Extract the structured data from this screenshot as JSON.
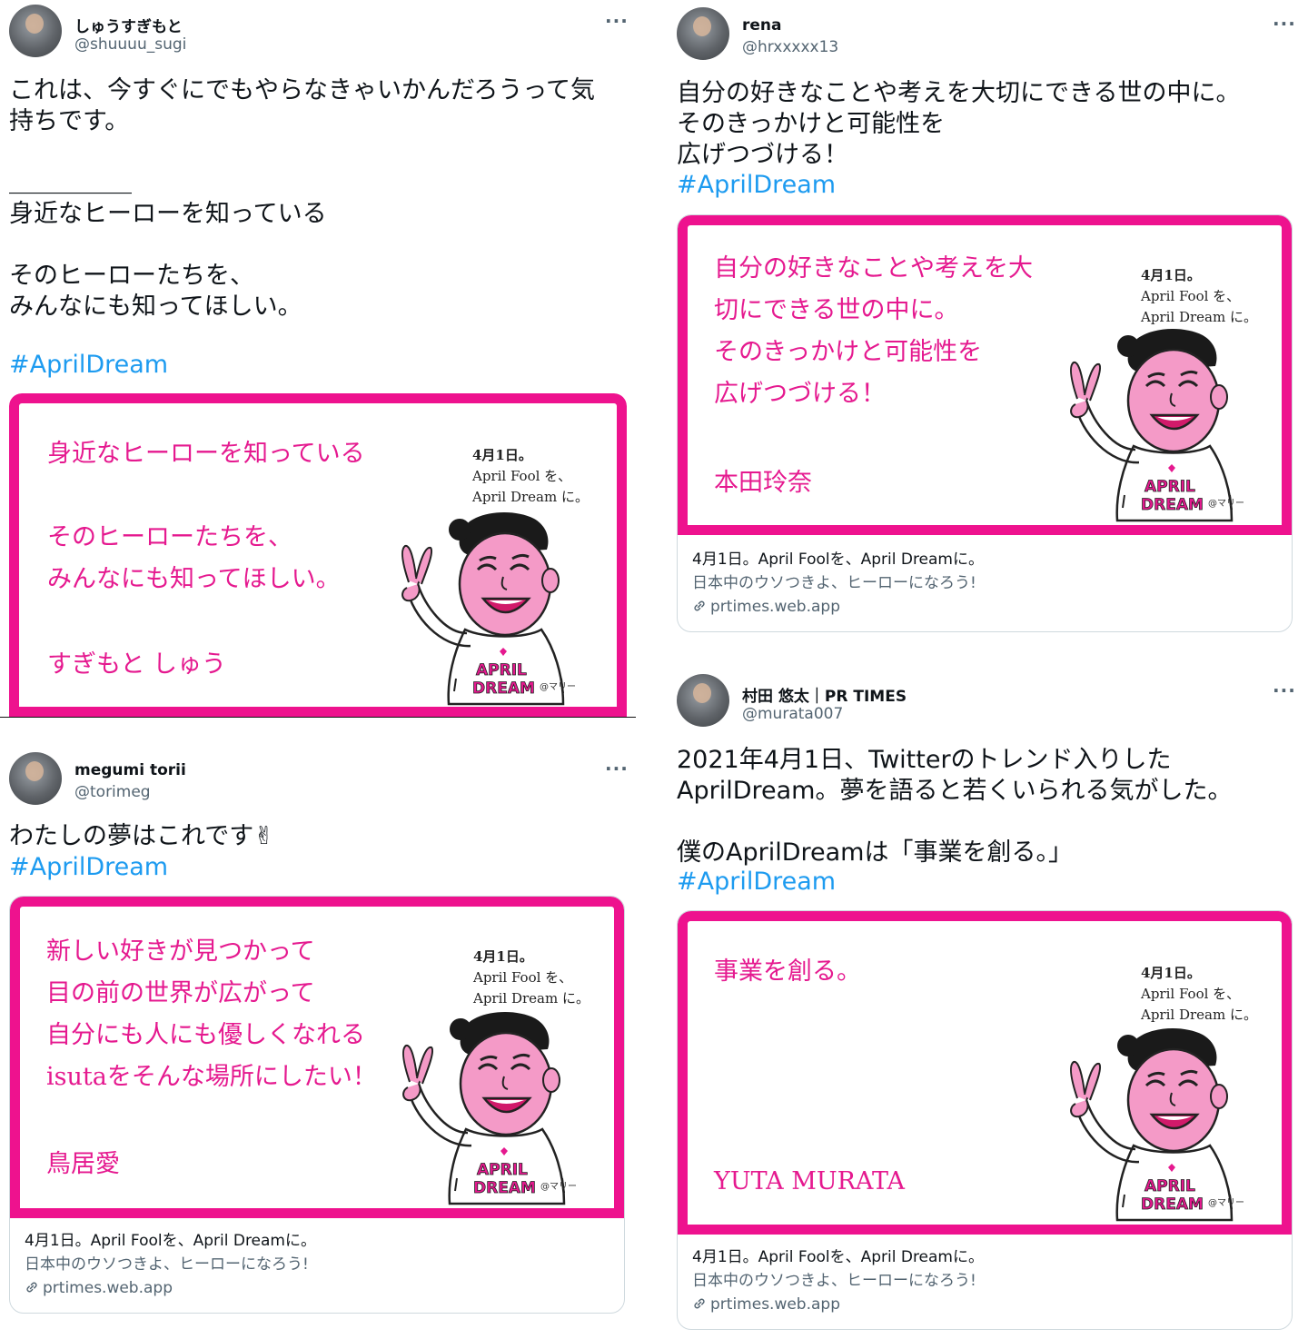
{
  "shared_card": {
    "header_line1": "4月1日。",
    "header_line2": "April Fool を、",
    "header_line3": "April Dream に。",
    "credit": "@マリー",
    "shirt_text": "APRIL DREAM",
    "link_title": "4月1日。April Foolを、April Dreamに。",
    "link_desc": "日本中のウソつきよ、ヒーローになろう!",
    "link_domain": "prtimes.web.app"
  },
  "colors": {
    "accent_pink": "#ee128e",
    "link_blue": "#1d9bf0",
    "muted": "#536471"
  },
  "tweets": [
    {
      "name": "しゅうすぎもと",
      "handle": "@shuuuu_sugi",
      "more": "···",
      "text": "これは、今すぐにでもやらなきゃいかんだろうって気\n持ちです。\n\n＿＿＿＿＿\n身近なヒーローを知っている\n\nそのヒーローたちを、\nみんなにも知ってほしい。",
      "hashtag": "#AprilDream",
      "card_message": "身近なヒーローを知っている\n\nそのヒーローたちを、\nみんなにも知ってほしい。",
      "card_sign": "すぎもと しゅう"
    },
    {
      "name": "rena",
      "handle": "@hrxxxxx13",
      "more": "···",
      "text": "自分の好きなことや考えを大切にできる世の中に。\nそのきっかけと可能性を\n広げつづける！",
      "hashtag": "#AprilDream",
      "card_message": "自分の好きなことや考えを大\n切にできる世の中に。\nそのきっかけと可能性を\n広げつづける！",
      "card_sign": "本田玲奈"
    },
    {
      "name": "megumi torii",
      "handle": "@torimeg",
      "more": "···",
      "text": "わたしの夢はこれです✌",
      "hashtag": "#AprilDream",
      "card_message": "新しい好きが見つかって\n目の前の世界が広がって\n自分にも人にも優しくなれる\nisutaをそんな場所にしたい！",
      "card_sign": "鳥居愛"
    },
    {
      "name": "村田 悠太｜PR TIMES",
      "handle": "@murata007",
      "more": "···",
      "text": "2021年4月1日、Twitterのトレンド入りした\nAprilDream。夢を語ると若くいられる気がした。\n\n僕のAprilDreamは「事業を創る。」",
      "hashtag": "#AprilDream",
      "card_message": "事業を創る。",
      "card_sign": "YUTA MURATA"
    }
  ]
}
